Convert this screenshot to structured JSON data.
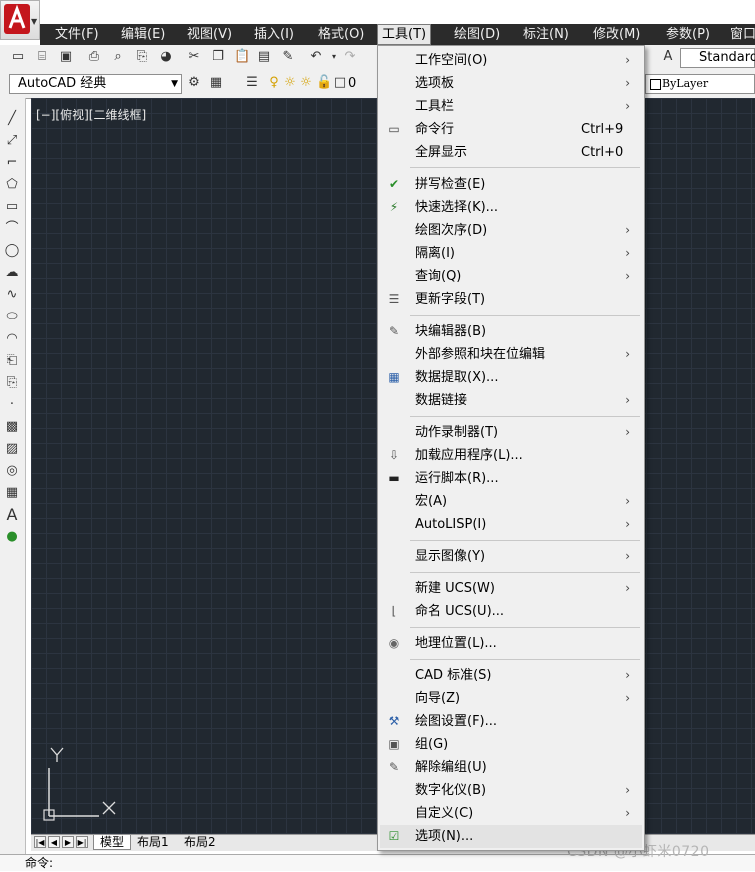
{
  "menubar": {
    "items": [
      "文件(F)",
      "编辑(E)",
      "视图(V)",
      "插入(I)",
      "格式(O)",
      "工具(T)",
      "绘图(D)",
      "标注(N)",
      "修改(M)",
      "参数(P)",
      "窗口"
    ]
  },
  "toolbar": {
    "workspace": "AutoCAD 经典",
    "text_style": "Standard",
    "layer": "0",
    "linetype": "ByLayer"
  },
  "viewport": {
    "label": "[−][俯视][二维线框]",
    "ucs_y": "Y"
  },
  "layout_tabs": [
    "模型",
    "布局1",
    "布局2"
  ],
  "tools_menu": {
    "items": [
      {
        "label": "工作空间(O)",
        "shortcut": "",
        "submenu": true,
        "icon": ""
      },
      {
        "label": "选项板",
        "shortcut": "",
        "submenu": true,
        "icon": ""
      },
      {
        "label": "工具栏",
        "shortcut": "",
        "submenu": true,
        "icon": ""
      },
      {
        "label": "命令行",
        "shortcut": "Ctrl+9",
        "submenu": false,
        "icon": "command-line-icon"
      },
      {
        "label": "全屏显示",
        "shortcut": "Ctrl+0",
        "submenu": false,
        "icon": ""
      },
      {
        "label": "拼写检查(E)",
        "shortcut": "",
        "submenu": false,
        "icon": "spell-check-icon"
      },
      {
        "label": "快速选择(K)...",
        "shortcut": "",
        "submenu": false,
        "icon": "quick-select-icon"
      },
      {
        "label": "绘图次序(D)",
        "shortcut": "",
        "submenu": true,
        "icon": ""
      },
      {
        "label": "隔离(I)",
        "shortcut": "",
        "submenu": true,
        "icon": ""
      },
      {
        "label": "查询(Q)",
        "shortcut": "",
        "submenu": true,
        "icon": ""
      },
      {
        "label": "更新字段(T)",
        "shortcut": "",
        "submenu": false,
        "icon": "update-field-icon"
      },
      {
        "label": "块编辑器(B)",
        "shortcut": "",
        "submenu": false,
        "icon": "block-editor-icon"
      },
      {
        "label": "外部参照和块在位编辑",
        "shortcut": "",
        "submenu": true,
        "icon": ""
      },
      {
        "label": "数据提取(X)...",
        "shortcut": "",
        "submenu": false,
        "icon": "data-extraction-icon"
      },
      {
        "label": "数据链接",
        "shortcut": "",
        "submenu": true,
        "icon": ""
      },
      {
        "label": "动作录制器(T)",
        "shortcut": "",
        "submenu": true,
        "icon": ""
      },
      {
        "label": "加载应用程序(L)...",
        "shortcut": "",
        "submenu": false,
        "icon": "load-application-icon"
      },
      {
        "label": "运行脚本(R)...",
        "shortcut": "",
        "submenu": false,
        "icon": "run-script-icon"
      },
      {
        "label": "宏(A)",
        "shortcut": "",
        "submenu": true,
        "icon": ""
      },
      {
        "label": "AutoLISP(I)",
        "shortcut": "",
        "submenu": true,
        "icon": ""
      },
      {
        "label": "显示图像(Y)",
        "shortcut": "",
        "submenu": true,
        "icon": ""
      },
      {
        "label": "新建 UCS(W)",
        "shortcut": "",
        "submenu": true,
        "icon": ""
      },
      {
        "label": "命名 UCS(U)...",
        "shortcut": "",
        "submenu": false,
        "icon": "named-ucs-icon"
      },
      {
        "label": "地理位置(L)...",
        "shortcut": "",
        "submenu": false,
        "icon": "geo-location-icon"
      },
      {
        "label": "CAD 标准(S)",
        "shortcut": "",
        "submenu": true,
        "icon": ""
      },
      {
        "label": "向导(Z)",
        "shortcut": "",
        "submenu": true,
        "icon": ""
      },
      {
        "label": "绘图设置(F)...",
        "shortcut": "",
        "submenu": false,
        "icon": "drafting-settings-icon"
      },
      {
        "label": "组(G)",
        "shortcut": "",
        "submenu": false,
        "icon": "group-icon"
      },
      {
        "label": "解除编组(U)",
        "shortcut": "",
        "submenu": false,
        "icon": "ungroup-icon"
      },
      {
        "label": "数字化仪(B)",
        "shortcut": "",
        "submenu": true,
        "icon": ""
      },
      {
        "label": "自定义(C)",
        "shortcut": "",
        "submenu": true,
        "icon": ""
      },
      {
        "label": "选项(N)...",
        "shortcut": "",
        "submenu": false,
        "icon": "options-check-icon"
      }
    ]
  },
  "command_line": {
    "prompt": "命令:"
  },
  "watermark": "CSDN @小虾米0720"
}
